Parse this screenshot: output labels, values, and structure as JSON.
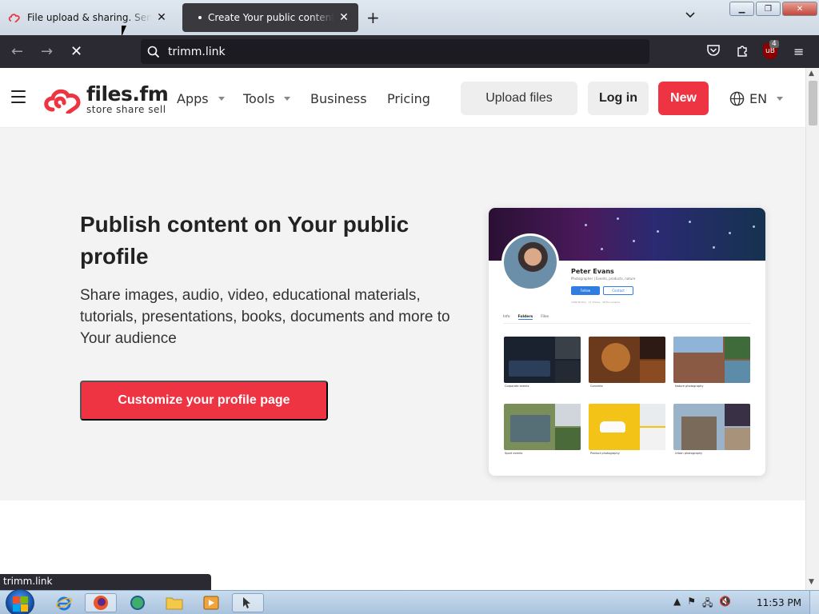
{
  "browser": {
    "tabs": [
      {
        "title": "File upload & sharing. Send large files",
        "active": false
      },
      {
        "title": "Create Your public content catalog",
        "active": true
      }
    ],
    "url": "trimm.link",
    "extension_badge": "4",
    "status_text": "trimm.link"
  },
  "header": {
    "logo_name": "files.fm",
    "logo_tagline": "store share sell",
    "menu": [
      {
        "label": "Apps",
        "has_dropdown": true
      },
      {
        "label": "Tools",
        "has_dropdown": true
      },
      {
        "label": "Business",
        "has_dropdown": false
      },
      {
        "label": "Pricing",
        "has_dropdown": false
      }
    ],
    "upload_label": "Upload files",
    "login_label": "Log in",
    "new_label": "New",
    "language": "EN"
  },
  "hero": {
    "title": "Publish content on Your public profile",
    "description": "Share images, audio, video, educational materials, tutorials, presentations, books, documents and more to Your audience",
    "cta_label": "Customize your profile page"
  },
  "preview": {
    "name": "Peter Evans",
    "subtitle": "Photographer | Events, products, nature",
    "follow_label": "Follow",
    "contact_label": "Contact",
    "stats": "1289 Photos · 17 Videos · 28 Documents",
    "tabs": [
      "Info",
      "Folders",
      "Files"
    ],
    "folders": [
      {
        "caption": "Corporate events"
      },
      {
        "caption": "Concerts"
      },
      {
        "caption": "Nature photography"
      },
      {
        "caption": "Sport events"
      },
      {
        "caption": "Product photography"
      },
      {
        "caption": "Urban photography"
      }
    ]
  },
  "taskbar": {
    "clock": "11:53 PM"
  },
  "colors": {
    "brand_red": "#ee3342",
    "hero_bg": "#f3f3f3",
    "browser_dark": "#2b2a33"
  }
}
